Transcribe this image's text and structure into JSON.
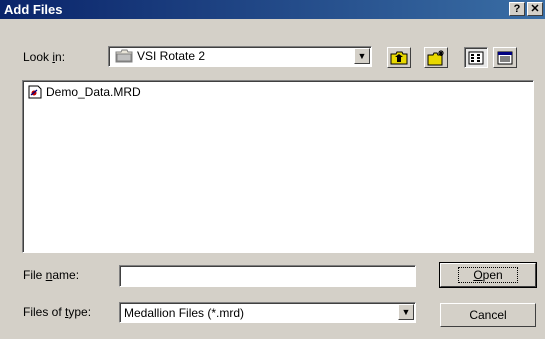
{
  "window": {
    "title": "Add Files",
    "help_label": "?",
    "close_label": "✕"
  },
  "lookin": {
    "label_pre": "Look ",
    "label_key": "i",
    "label_post": "n:",
    "value": "VSI Rotate 2"
  },
  "files": [
    {
      "name": "Demo_Data.MRD"
    }
  ],
  "filename": {
    "label_pre": "File ",
    "label_key": "n",
    "label_post": "ame:",
    "value": ""
  },
  "filetype": {
    "label_pre": "Files of ",
    "label_key": "t",
    "label_post": "ype:",
    "value": "Medallion Files (*.mrd)"
  },
  "buttons": {
    "open_key": "O",
    "open_rest": "pen",
    "cancel": "Cancel"
  },
  "colors": {
    "title_start": "#0a246a",
    "title_end": "#3a6ea5",
    "face": "#d4d0c8"
  },
  "icons": {
    "folder": "folder-icon",
    "up": "up-folder-icon",
    "new": "new-folder-icon",
    "list": "list-view-icon",
    "details": "details-view-icon",
    "file": "mrd-file-icon"
  }
}
